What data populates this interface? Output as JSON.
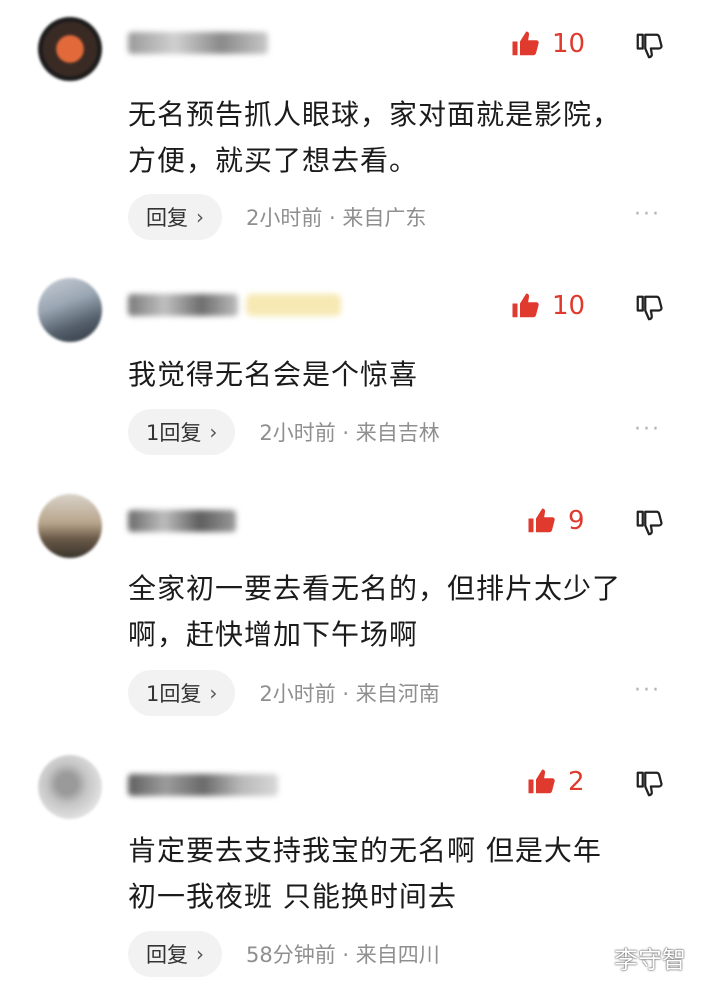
{
  "comments": [
    {
      "likes": "10",
      "text_line1": "无名预告抓人眼球，家对面就是影院，",
      "text_line2": "方便，就买了想去看。",
      "reply_label": "回复",
      "meta": "2小时前 · 来自广东"
    },
    {
      "likes": "10",
      "text_line1": "我觉得无名会是个惊喜",
      "text_line2": "",
      "reply_label": "1回复",
      "meta": "2小时前 · 来自吉林"
    },
    {
      "likes": "9",
      "text_line1": "全家初一要去看无名的，但排片太少了",
      "text_line2": "啊，赶快增加下午场啊",
      "reply_label": "1回复",
      "meta": "2小时前 · 来自河南"
    },
    {
      "likes": "2",
      "text_line1": "肯定要去支持我宝的无名啊 但是大年",
      "text_line2": "初一我夜班 只能换时间去",
      "reply_label": "回复",
      "meta": "58分钟前 · 来自四川"
    }
  ],
  "more_label": "···",
  "chevron": "›",
  "watermark": "李守智",
  "colors": {
    "like_red": "#e03a2e",
    "meta_gray": "#8f8f8f",
    "reply_bg": "#f2f2f2"
  },
  "icons": {
    "like": "thumbs-up-icon",
    "dislike": "thumbs-down-icon"
  }
}
